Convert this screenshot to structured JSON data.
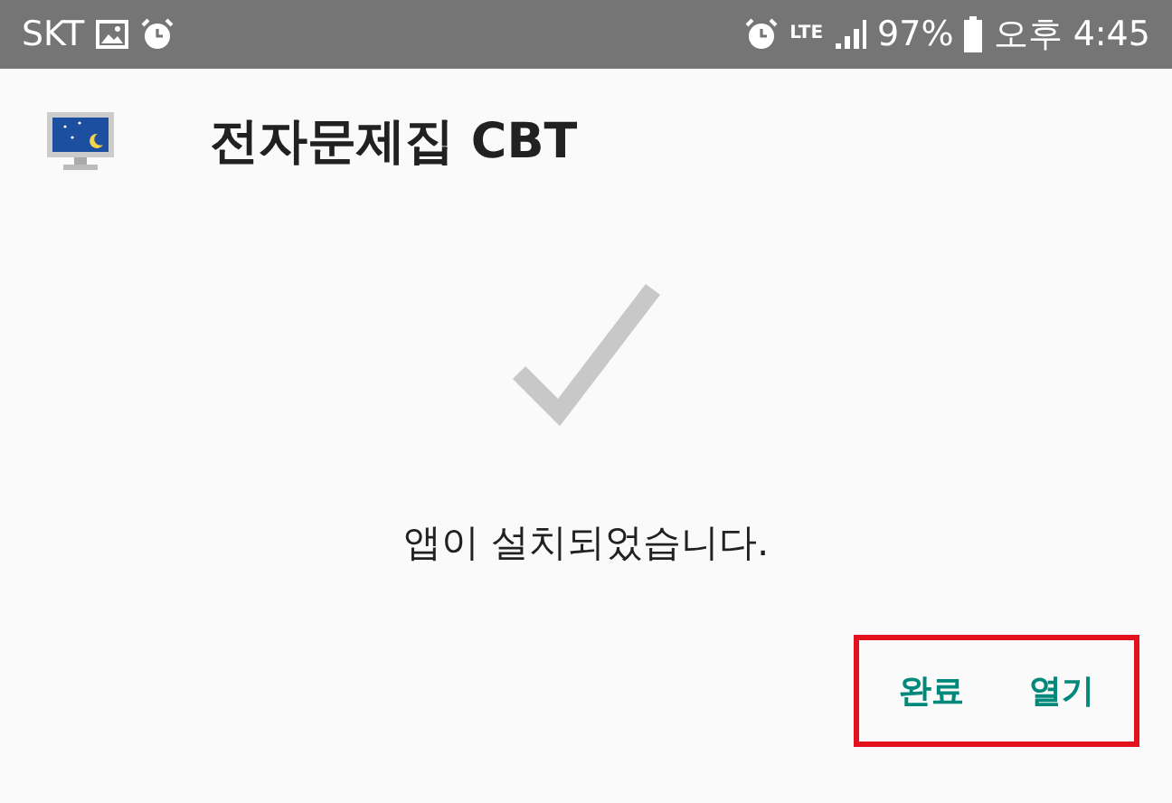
{
  "status_bar": {
    "carrier": "SKT",
    "network": "LTE",
    "battery": "97%",
    "time": "오후 4:45"
  },
  "app": {
    "title": "전자문제집 CBT"
  },
  "message": "앱이 설치되었습니다.",
  "buttons": [
    {
      "label": "완료"
    },
    {
      "label": "열기"
    }
  ],
  "highlight": {
    "color": "#e3101e"
  }
}
